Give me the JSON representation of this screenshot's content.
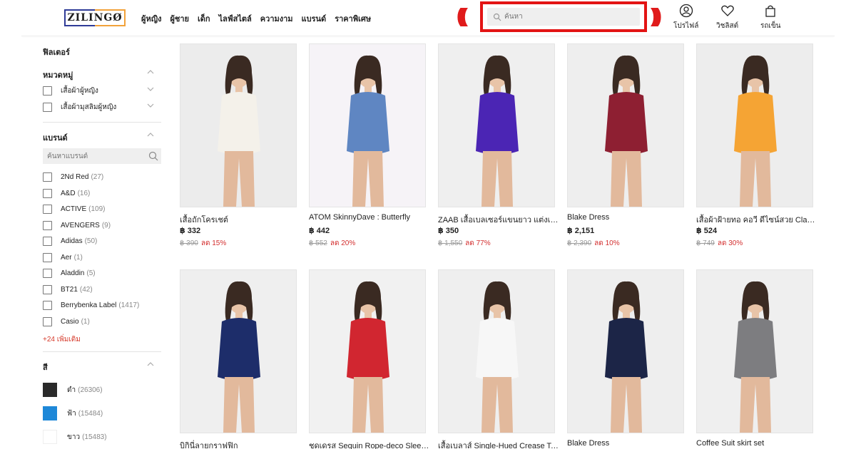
{
  "brand": {
    "logo_text": "ZILINGØ"
  },
  "nav": [
    "ผู้หญิง",
    "ผู้ชาย",
    "เด็ก",
    "ไลฟ์สไตล์",
    "ความงาม",
    "แบรนด์",
    "ราคาพิเศษ"
  ],
  "search": {
    "placeholder": "ค้นหา"
  },
  "header_actions": {
    "profile": "โปรไฟล์",
    "wishlist": "วิชลิสต์",
    "cart": "รถเข็น"
  },
  "colors": {
    "highlight": "#e31414",
    "discount": "#d32f2f",
    "link": "#d63a2b"
  },
  "sidebar": {
    "title": "ฟิลเตอร์",
    "category": {
      "title": "หมวดหมู่",
      "items": [
        "เสื้อผ้าผู้หญิง",
        "เสื้อผ้ามุสลิมผู้หญิง"
      ]
    },
    "brands": {
      "title": "แบรนด์",
      "search_placeholder": "ค้นหาแบรนด์",
      "items": [
        {
          "name": "2Nd Red",
          "count": "(27)"
        },
        {
          "name": "A&D",
          "count": "(16)"
        },
        {
          "name": "ACTIVE",
          "count": "(109)"
        },
        {
          "name": "AVENGERS",
          "count": "(9)"
        },
        {
          "name": "Adidas",
          "count": "(50)"
        },
        {
          "name": "Aer",
          "count": "(1)"
        },
        {
          "name": "Aladdin",
          "count": "(5)"
        },
        {
          "name": "BT21",
          "count": "(42)"
        },
        {
          "name": "Berrybenka Label",
          "count": "(1417)"
        },
        {
          "name": "Casio",
          "count": "(1)"
        }
      ],
      "more": "+24 เพิ่มเติม"
    },
    "color": {
      "title": "สี",
      "items": [
        {
          "name": "ดำ",
          "count": "(26306)",
          "hex": "#2a2a2a"
        },
        {
          "name": "ฟ้า",
          "count": "(15484)",
          "hex": "#1e88d8"
        },
        {
          "name": "ขาว",
          "count": "(15483)",
          "hex": "#ffffff"
        }
      ]
    }
  },
  "products": [
    {
      "name": "เสื้อถักโครเชต์",
      "price": "฿ 332",
      "original": "฿ 390",
      "discount": "ลด 15%",
      "bg": "#ececec",
      "outfit": "#f4f1ea"
    },
    {
      "name": "ATOM SkinnyDave : Butterfly",
      "price": "฿ 442",
      "original": "฿ 552",
      "discount": "ลด 20%",
      "bg": "#f6f3f7",
      "outfit": "#5f86c2"
    },
    {
      "name": "ZAAB เสื้อเบลเซอร์แขนยาว แต่งเชือก",
      "price": "฿ 350",
      "original": "฿ 1,550",
      "discount": "ลด 77%",
      "bg": "#efefef",
      "outfit": "#4b25b4"
    },
    {
      "name": "Blake Dress",
      "price": "฿ 2,151",
      "original": "฿ 2,390",
      "discount": "ลด 10%",
      "bg": "#eeeeee",
      "outfit": "#8e1f32"
    },
    {
      "name": "เสื้อผ้าฝ้ายทอ คอวี ดีไซน์สวย Classic",
      "price": "฿ 524",
      "original": "฿ 749",
      "discount": "ลด 30%",
      "bg": "#ededed",
      "outfit": "#f5a434"
    },
    {
      "name": "บิกินี่ลายกราฟฟิก",
      "price": "",
      "original": "",
      "discount": "",
      "bg": "#efefef",
      "outfit": "#1d2d6a"
    },
    {
      "name": "ชุดเดรส Sequin Rope-deco Sleeveless",
      "price": "",
      "original": "",
      "discount": "",
      "bg": "#f1f1f1",
      "outfit": "#d12630"
    },
    {
      "name": "เสื้อเบลาส์ Single-Hued Crease Top",
      "price": "",
      "original": "",
      "discount": "",
      "bg": "#efefef",
      "outfit": "#f7f7f7"
    },
    {
      "name": "Blake Dress",
      "price": "",
      "original": "",
      "discount": "",
      "bg": "#eeeeee",
      "outfit": "#1c2547"
    },
    {
      "name": "Coffee Suit skirt set",
      "price": "",
      "original": "",
      "discount": "",
      "bg": "#efefef",
      "outfit": "#7d7d80"
    }
  ]
}
